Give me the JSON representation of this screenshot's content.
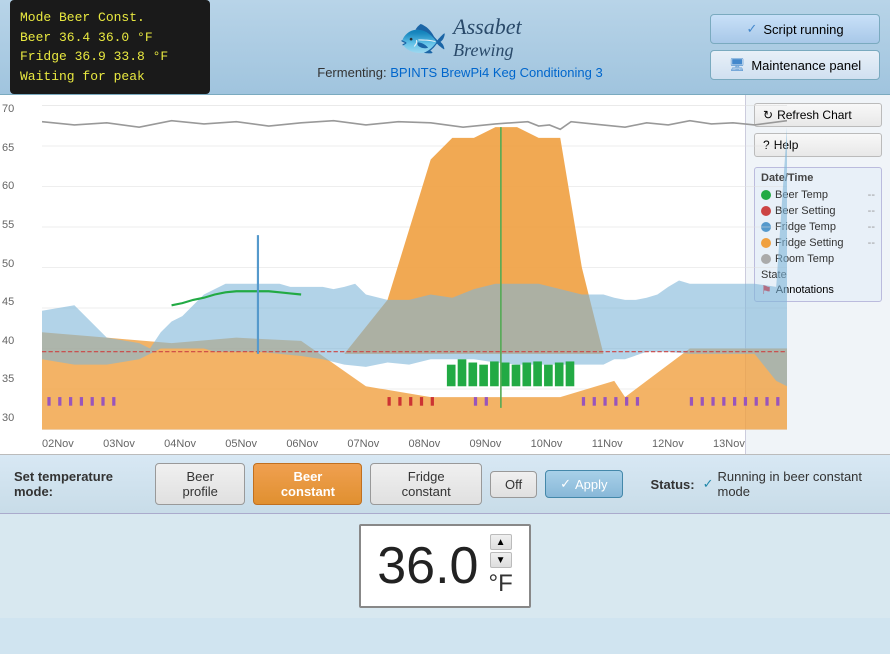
{
  "header": {
    "led_line1": "Mode  Beer Const.",
    "led_line2": "Beer  36.4  36.0 °F",
    "led_line3": "Fridge 36.9  33.8 °F",
    "led_line4": "Waiting for peak",
    "logo_line1": "Assabet",
    "logo_line2": "Brewing",
    "fermenting_label": "Fermenting:",
    "fermenting_link": "BPINTS BrewPi4 Keg Conditioning 3",
    "script_running": "Script running",
    "maintenance_panel": "Maintenance panel"
  },
  "chart": {
    "refresh_label": "Refresh Chart",
    "help_label": "Help",
    "legend": {
      "title": "Date/Time",
      "beer_temp": "Beer Temp",
      "beer_setting": "Beer Setting",
      "fridge_temp": "Fridge Temp",
      "fridge_setting": "Fridge Setting",
      "room_temp": "Room Temp",
      "state": "State",
      "annotations": "Annotations"
    },
    "x_labels": [
      "02Nov",
      "03Nov",
      "04Nov",
      "05Nov",
      "06Nov",
      "07Nov",
      "08Nov",
      "09Nov",
      "10Nov",
      "11Nov",
      "12Nov",
      "13Nov"
    ],
    "y_labels": [
      "70",
      "65",
      "60",
      "55",
      "50",
      "45",
      "40",
      "35",
      "30"
    ]
  },
  "controls": {
    "set_temp_mode_label": "Set temperature mode:",
    "beer_profile_label": "Beer profile",
    "beer_constant_label": "Beer constant",
    "fridge_constant_label": "Fridge constant",
    "off_label": "Off",
    "apply_label": "Apply",
    "status_label": "Status:",
    "status_text": "Running in beer constant mode"
  },
  "temp_display": {
    "value": "36.0",
    "unit": "°F"
  }
}
